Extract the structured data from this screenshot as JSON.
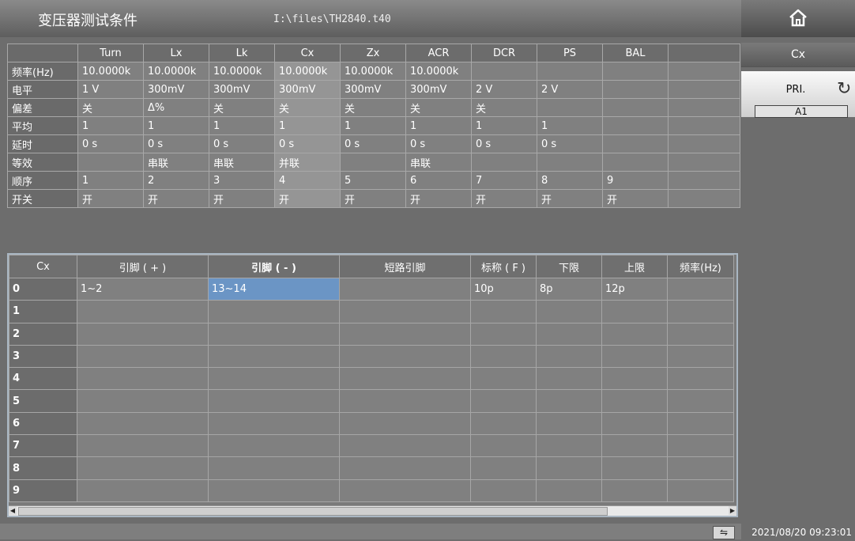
{
  "header": {
    "title": "变压器测试条件",
    "file_path": "I:\\files\\TH2840.t40"
  },
  "conditions": {
    "columns": [
      "Turn",
      "Lx",
      "Lk",
      "Cx",
      "Zx",
      "ACR",
      "DCR",
      "PS",
      "BAL",
      ""
    ],
    "rows": [
      {
        "label": "频率(Hz)",
        "cells": [
          "10.0000k",
          "10.0000k",
          "10.0000k",
          "10.0000k",
          "10.0000k",
          "10.0000k",
          "",
          "",
          "",
          ""
        ]
      },
      {
        "label": "电平",
        "cells": [
          "1 V",
          "300mV",
          "300mV",
          "300mV",
          "300mV",
          "300mV",
          "2 V",
          "2 V",
          "",
          ""
        ]
      },
      {
        "label": "偏差",
        "cells": [
          "关",
          "Δ%",
          "关",
          "关",
          "关",
          "关",
          "关",
          "",
          "",
          ""
        ]
      },
      {
        "label": "平均",
        "cells": [
          "1",
          "1",
          "1",
          "1",
          "1",
          "1",
          "1",
          "1",
          "",
          ""
        ]
      },
      {
        "label": "延时",
        "cells": [
          "0 s",
          "0 s",
          "0 s",
          "0 s",
          "0 s",
          "0 s",
          "0 s",
          "0 s",
          "",
          ""
        ]
      },
      {
        "label": "等效",
        "cells": [
          "",
          "串联",
          "串联",
          "并联",
          "",
          "串联",
          "",
          "",
          "",
          ""
        ]
      },
      {
        "label": "顺序",
        "cells": [
          "1",
          "2",
          "3",
          "4",
          "5",
          "6",
          "7",
          "8",
          "9",
          ""
        ]
      },
      {
        "label": "开关",
        "cells": [
          "开",
          "开",
          "开",
          "开",
          "开",
          "开",
          "开",
          "开",
          "开",
          ""
        ]
      }
    ]
  },
  "sidebar": {
    "header": "Cx",
    "button_label": "PRI.",
    "button_value": "A1"
  },
  "pin_table": {
    "columns": [
      "Cx",
      "引脚 ( + )",
      "引脚 ( - )",
      "短路引脚",
      "标称 ( F )",
      "下限",
      "上限",
      "频率(Hz)"
    ],
    "rows": [
      {
        "index": "0",
        "values": [
          "1~2",
          "13~14",
          "",
          "10p",
          "8p",
          "12p",
          ""
        ]
      },
      {
        "index": "1",
        "values": [
          "",
          "",
          "",
          "",
          "",
          "",
          ""
        ]
      },
      {
        "index": "2",
        "values": [
          "",
          "",
          "",
          "",
          "",
          "",
          ""
        ]
      },
      {
        "index": "3",
        "values": [
          "",
          "",
          "",
          "",
          "",
          "",
          ""
        ]
      },
      {
        "index": "4",
        "values": [
          "",
          "",
          "",
          "",
          "",
          "",
          ""
        ]
      },
      {
        "index": "5",
        "values": [
          "",
          "",
          "",
          "",
          "",
          "",
          ""
        ]
      },
      {
        "index": "6",
        "values": [
          "",
          "",
          "",
          "",
          "",
          "",
          ""
        ]
      },
      {
        "index": "7",
        "values": [
          "",
          "",
          "",
          "",
          "",
          "",
          ""
        ]
      },
      {
        "index": "8",
        "values": [
          "",
          "",
          "",
          "",
          "",
          "",
          ""
        ]
      },
      {
        "index": "9",
        "values": [
          "",
          "",
          "",
          "",
          "",
          "",
          ""
        ]
      }
    ]
  },
  "status": {
    "datetime": "2021/08/20 09:23:01"
  },
  "colors": {
    "highlight": "#6b95c5",
    "background": "#6d6d6d"
  },
  "icons": {
    "home": "home-icon",
    "cycle": "cycle-arrow-icon",
    "usb": "usb-icon"
  }
}
